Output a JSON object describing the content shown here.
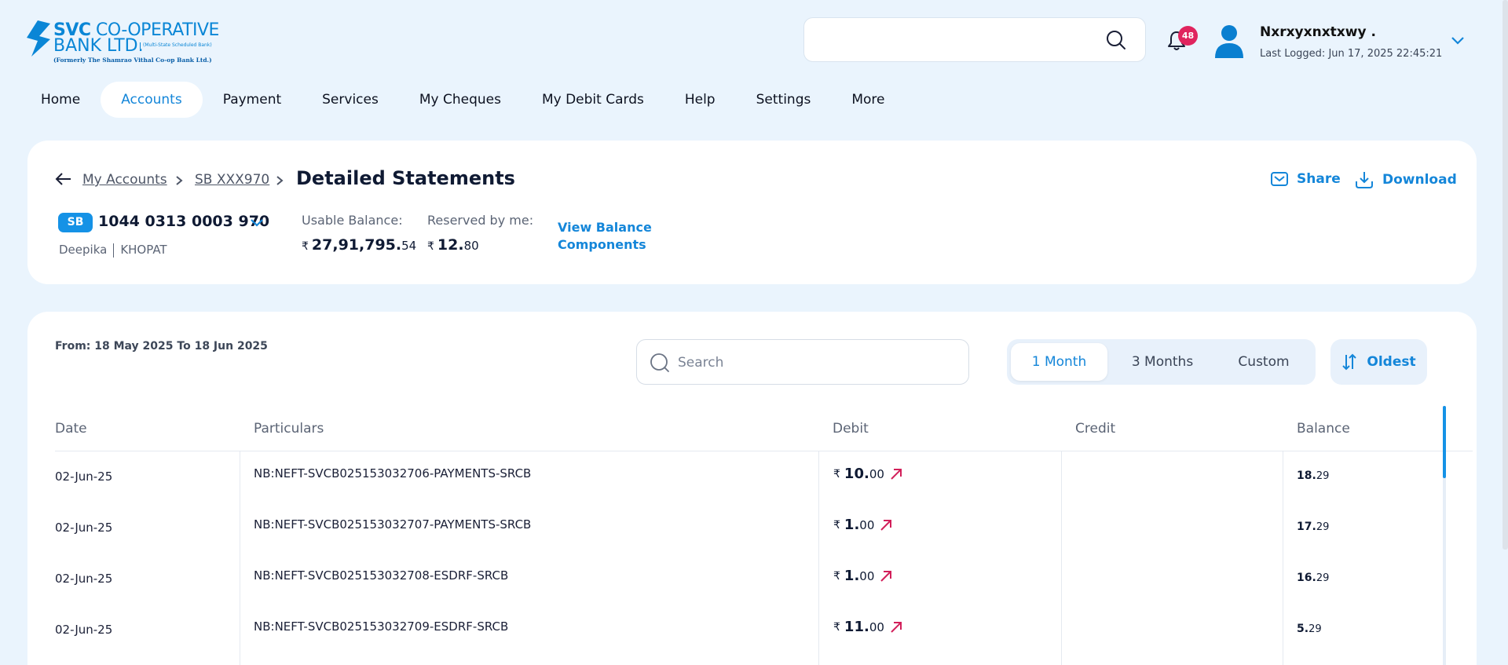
{
  "logo": {
    "line1_bold": "SVC",
    "line1": " CO-OPERATIVE",
    "line2": "BANK LTD.",
    "tag": "(Multi-State Scheduled Bank)",
    "line3": "(Formerly The Shamrao Vithal Co-op Bank Ltd.)"
  },
  "header": {
    "search_placeholder": "",
    "notification_count": "48",
    "user_name": "Nxrxyxnxtxwy .",
    "last_logged": "Last Logged: Jun 17, 2025 22:45:21"
  },
  "nav": [
    "Home",
    "Accounts",
    "Payment",
    "Services",
    "My Cheques",
    "My Debit Cards",
    "Help",
    "Settings",
    "More"
  ],
  "nav_active": "Accounts",
  "breadcrumb": {
    "item1": "My Accounts",
    "item2": "SB XXX970",
    "current": "Detailed Statements"
  },
  "actions": {
    "share": "Share",
    "download": "Download"
  },
  "account": {
    "type_badge": "SB",
    "number": "1044 0313 0003 970",
    "holder": "Deepika",
    "branch": "KHOPAT",
    "usable_label": "Usable Balance:",
    "usable_int": "27,91,795.",
    "usable_dec": "54",
    "reserved_label": "Reserved by me:",
    "reserved_int": "12.",
    "reserved_dec": "80",
    "currency": "₹",
    "view_components": "View Balance Components"
  },
  "statement": {
    "range": "From: 18 May 2025 To 18 Jun 2025",
    "search_placeholder": "Search",
    "periods": [
      "1 Month",
      "3 Months",
      "Custom"
    ],
    "active_period": "1 Month",
    "sort_label": "Oldest",
    "columns": [
      "Date",
      "Particulars",
      "Debit",
      "Credit",
      "Balance"
    ],
    "rows": [
      {
        "date": "02-Jun-25",
        "particulars": "NB:NEFT-SVCB025153032706-PAYMENTS-SRCB",
        "debit_int": "10.",
        "debit_dec": "00",
        "credit": "",
        "bal_int": "18.",
        "bal_dec": "29"
      },
      {
        "date": "02-Jun-25",
        "particulars": "NB:NEFT-SVCB025153032707-PAYMENTS-SRCB",
        "debit_int": "1.",
        "debit_dec": "00",
        "credit": "",
        "bal_int": "17.",
        "bal_dec": "29"
      },
      {
        "date": "02-Jun-25",
        "particulars": "NB:NEFT-SVCB025153032708-ESDRF-SRCB",
        "debit_int": "1.",
        "debit_dec": "00",
        "credit": "",
        "bal_int": "16.",
        "bal_dec": "29"
      },
      {
        "date": "02-Jun-25",
        "particulars": "NB:NEFT-SVCB025153032709-ESDRF-SRCB",
        "debit_int": "11.",
        "debit_dec": "00",
        "credit": "",
        "bal_int": "5.",
        "bal_dec": "29"
      }
    ]
  },
  "colors": {
    "accent": "#1486d9",
    "debit_arrow": "#d21f5a",
    "badge": "#e0245e",
    "page_bg": "#eaf4fd"
  }
}
